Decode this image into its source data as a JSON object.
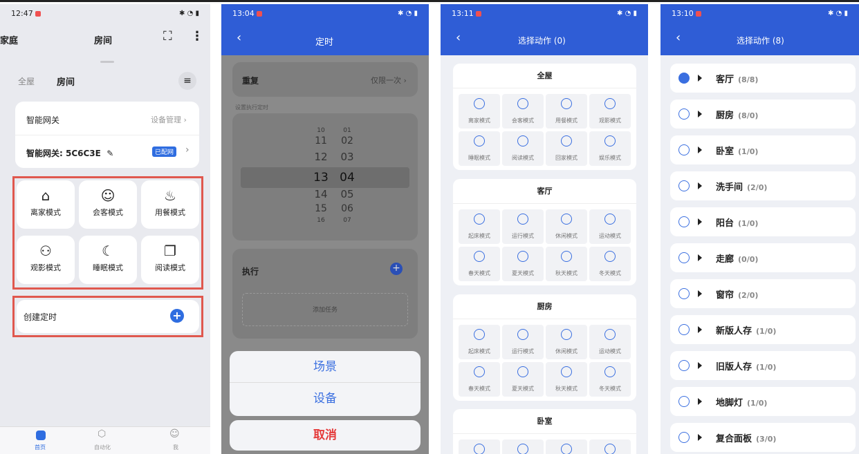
{
  "p1": {
    "time": "12:47",
    "home": "家庭",
    "title": "房间",
    "tab_all": "全屋",
    "tab_room": "房间",
    "gateway": "智能网关",
    "device_mgmt": "设备管理",
    "gateway_name": "智能网关: 5C6C3E",
    "paired": "已配网",
    "modes": [
      "离家模式",
      "会客模式",
      "用餐模式",
      "观影模式",
      "睡眠模式",
      "阅读模式"
    ],
    "create_timer": "创建定时",
    "nav": [
      "首页",
      "自动化",
      "我"
    ]
  },
  "p2": {
    "time": "13:04",
    "title": "定时",
    "repeat": "重复",
    "repeat_val": "仅限一次",
    "exec_time": "设置执行定时",
    "hours": [
      "10",
      "11",
      "12",
      "13",
      "14",
      "15",
      "16"
    ],
    "mins": [
      "01",
      "02",
      "03",
      "04",
      "05",
      "06",
      "07"
    ],
    "exec": "执行",
    "add_task": "添加任务",
    "opt1": "场景",
    "opt2": "设备",
    "cancel": "取消"
  },
  "p3": {
    "time": "13:11",
    "title": "选择动作 (0)",
    "sections": [
      {
        "name": "全屋",
        "items": [
          "离家模式",
          "会客模式",
          "用餐模式",
          "观影模式",
          "睡眠模式",
          "阅读模式",
          "回家模式",
          "娱乐模式"
        ]
      },
      {
        "name": "客厅",
        "items": [
          "起床模式",
          "运行模式",
          "休闲模式",
          "运动模式",
          "春天模式",
          "夏天模式",
          "秋天模式",
          "冬天模式"
        ]
      },
      {
        "name": "厨房",
        "items": [
          "起床模式",
          "运行模式",
          "休闲模式",
          "运动模式",
          "春天模式",
          "夏天模式",
          "秋天模式",
          "冬天模式"
        ]
      },
      {
        "name": "卧室",
        "items": []
      }
    ]
  },
  "p4": {
    "time": "13:10",
    "title": "选择动作 (8)",
    "rows": [
      {
        "name": "客厅",
        "count": "(8/8)"
      },
      {
        "name": "厨房",
        "count": "(8/0)"
      },
      {
        "name": "卧室",
        "count": "(1/0)"
      },
      {
        "name": "洗手间",
        "count": "(2/0)"
      },
      {
        "name": "阳台",
        "count": "(1/0)"
      },
      {
        "name": "走廊",
        "count": "(0/0)"
      },
      {
        "name": "窗帘",
        "count": "(2/0)"
      },
      {
        "name": "新版人存",
        "count": "(1/0)"
      },
      {
        "name": "旧版人存",
        "count": "(1/0)"
      },
      {
        "name": "地脚灯",
        "count": "(1/0)"
      },
      {
        "name": "复合面板",
        "count": "(3/0)"
      }
    ]
  }
}
